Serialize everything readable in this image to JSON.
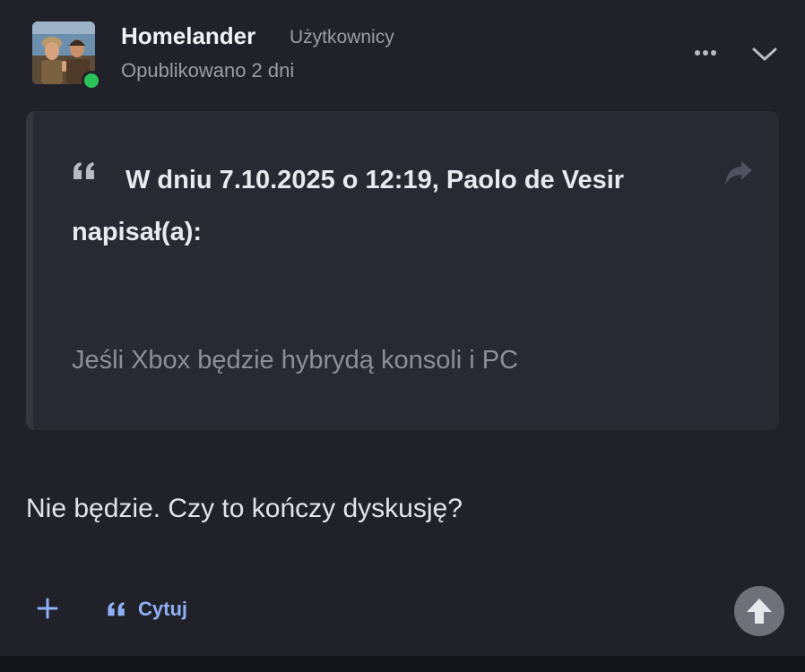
{
  "author": {
    "name": "Homelander",
    "group": "Użytkownicy",
    "published": "Opublikowano 2 dni",
    "online_color": "#2bc45a",
    "avatar_icon": "avatar-photo"
  },
  "header_actions": {
    "more_icon": "ellipsis-icon",
    "collapse_icon": "chevron-down-icon"
  },
  "quote": {
    "header": "W dniu 7.10.2025 o 12:19, Paolo de Vesir napisał(a):",
    "body": "Jeśli Xbox będzie hybrydą konsoli i PC",
    "quote_icon": "quote-icon",
    "share_icon": "share-arrow-icon"
  },
  "post": {
    "text": "Nie będzie. Czy to kończy dyskusję?"
  },
  "actions": {
    "add_icon": "plus-icon",
    "quote_label": "Cytuj",
    "quote_icon": "quote-icon",
    "scroll_top_icon": "arrow-up-icon",
    "accent_color": "#8fb0f5"
  }
}
